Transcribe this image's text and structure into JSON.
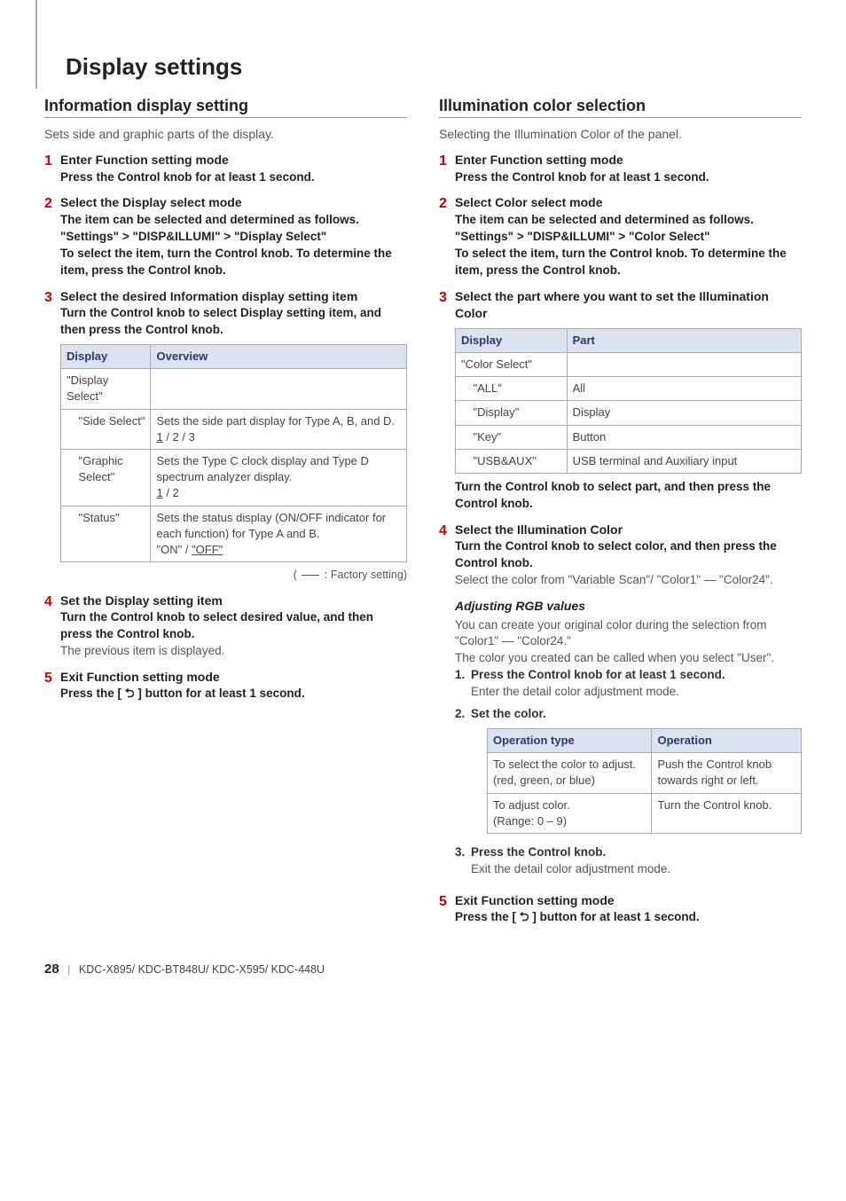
{
  "page_title": "Display settings",
  "left": {
    "heading": "Information display setting",
    "intro": "Sets side and graphic parts of the display.",
    "steps": [
      {
        "num": "1",
        "title": "Enter Function setting mode",
        "sub": "Press the Control knob for at least 1 second."
      },
      {
        "num": "2",
        "title": "Select the Display select mode",
        "sub": "The item can be selected and determined as follows.",
        "crumb_prefix": "\"Settings\"",
        "crumb_mid": "\"DISP&ILLUMI\"",
        "crumb_end": "\"Display Select\"",
        "sub2": "To select the item, turn the Control knob. To determine the item, press the Control knob."
      },
      {
        "num": "3",
        "title": "Select the desired Information display setting item",
        "sub": "Turn the Control knob to select Display setting item, and then press the Control knob."
      },
      {
        "num": "4",
        "title": "Set the Display setting item",
        "sub": "Turn the Control knob to select desired value, and then press the Control knob.",
        "text": "The previous item is displayed."
      },
      {
        "num": "5",
        "title": "Exit Function setting mode",
        "sub_prefix": "Press the [ ",
        "sub_suffix": " ] button for at least 1 second."
      }
    ],
    "table": {
      "headers": [
        "Display",
        "Overview"
      ],
      "parent": "\"Display Select\"",
      "rows": [
        {
          "label": "\"Side Select\"",
          "text_a": "Sets the side part display for Type A, B, and D.",
          "vals": " / 2 / 3",
          "default": "1"
        },
        {
          "label": "\"Graphic Select\"",
          "text_a": "Sets the Type C clock display and Type D spectrum analyzer display.",
          "vals": " / 2",
          "default": "1"
        },
        {
          "label": "\"Status\"",
          "text_a": "Sets the status display (ON/OFF indicator for each function) for Type A and B.",
          "vals_prefix": "\"ON\" / ",
          "default": "\"OFF\""
        }
      ]
    },
    "factory_note": " : Factory setting)"
  },
  "right": {
    "heading": "Illumination color selection",
    "intro": "Selecting the Illumination Color of the panel.",
    "steps": [
      {
        "num": "1",
        "title": "Enter Function setting mode",
        "sub": "Press the Control knob for at least 1 second."
      },
      {
        "num": "2",
        "title": "Select Color select mode",
        "sub": "The item can be selected and determined as follows.",
        "crumb_prefix": "\"Settings\"",
        "crumb_mid": "\"DISP&ILLUMI\"",
        "crumb_end": "\"Color Select\"",
        "sub2": "To select the item, turn the Control knob. To determine the item, press the Control knob."
      },
      {
        "num": "3",
        "title": "Select the part where you want to set the Illumination Color"
      }
    ],
    "table": {
      "headers": [
        "Display",
        "Part"
      ],
      "parent": "\"Color Select\"",
      "rows": [
        {
          "label": "\"ALL\"",
          "part": "All"
        },
        {
          "label": "\"Display\"",
          "part": "Display"
        },
        {
          "label": "\"Key\"",
          "part": "Button"
        },
        {
          "label": "\"USB&AUX\"",
          "part": "USB terminal and Auxiliary input"
        }
      ]
    },
    "after_table_sub": "Turn the Control knob to select part, and then press the Control knob.",
    "step4": {
      "num": "4",
      "title": "Select the Illumination Color",
      "sub": "Turn the Control knob to select color, and then press the Control knob.",
      "text": "Select the color from \"Variable Scan\"/ \"Color1\" — \"Color24\"."
    },
    "rgb": {
      "heading": "Adjusting RGB values",
      "text1": "You can create your original color during the selection from \"Color1\" — \"Color24.\"",
      "text2": "The color you created can be called when you select \"User\".",
      "items": [
        {
          "num": "1.",
          "title": "Press the Control knob for at least 1 second.",
          "text": "Enter the detail color adjustment mode."
        },
        {
          "num": "2.",
          "title": "Set the color."
        },
        {
          "num": "3.",
          "title": "Press the Control knob.",
          "text": "Exit the detail color adjustment mode."
        }
      ],
      "table": {
        "headers": [
          "Operation type",
          "Operation"
        ],
        "rows": [
          {
            "a": "To select the color to adjust. (red, green, or blue)",
            "b": "Push the Control knob towards right or left."
          },
          {
            "a": "To adjust color.\n(Range: 0 – 9)",
            "b": "Turn the Control knob."
          }
        ]
      }
    },
    "step5": {
      "num": "5",
      "title": "Exit Function setting mode",
      "sub_prefix": "Press the [ ",
      "sub_suffix": " ] button for at least 1 second."
    }
  },
  "footer": {
    "pagenum": "28",
    "models": "KDC-X895/ KDC-BT848U/ KDC-X595/ KDC-448U"
  },
  "icons": {
    "arrow": ">",
    "return": "⮌"
  }
}
